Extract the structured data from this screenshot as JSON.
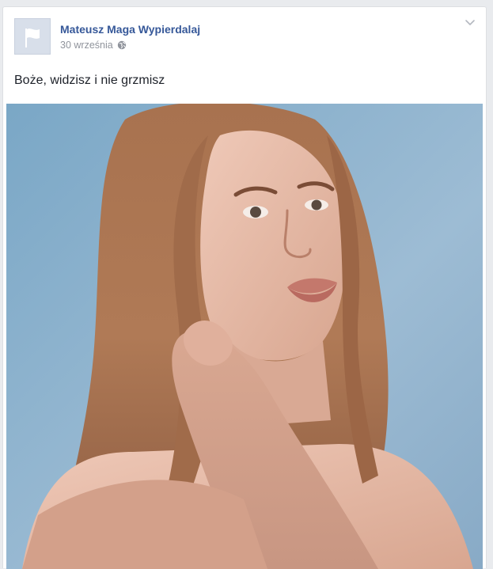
{
  "post": {
    "author": "Mateusz Maga Wypierdalaj",
    "timestamp": "30 września",
    "audience_icon": "globe-icon",
    "options_icon": "chevron-down-icon",
    "avatar_icon": "flag-icon",
    "text": "Boże, widzisz i nie grzmisz",
    "photo": {
      "subject": "portrait photo",
      "background_color": "#8fb0cc"
    }
  },
  "colors": {
    "author_link": "#365899",
    "meta_text": "#90949c",
    "body_text": "#1d2129",
    "page_background": "#e9ebee"
  }
}
